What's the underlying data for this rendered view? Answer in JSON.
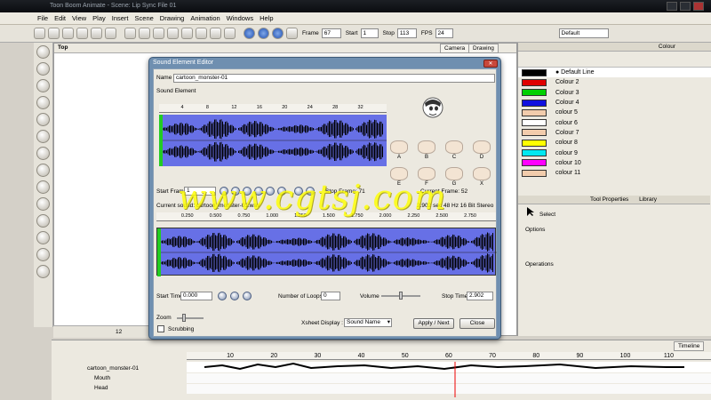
{
  "window": {
    "title": "Toon Boom Animate - Scene: Lip Sync File 01"
  },
  "menu": [
    "File",
    "Edit",
    "View",
    "Play",
    "Insert",
    "Scene",
    "Drawing",
    "Animation",
    "Windows",
    "Help"
  ],
  "toolbar": {
    "frame_label": "Frame",
    "frame_value": "67",
    "start_label": "Start",
    "start_value": "1",
    "stop_label": "Stop",
    "stop_value": "113",
    "fps_label": "FPS",
    "fps_value": "24",
    "workspace": "Default"
  },
  "viewport": {
    "view_label": "Top",
    "tabs": [
      "Camera",
      "Drawing"
    ],
    "zoom": "12"
  },
  "colour_panel": {
    "tab": "Colour",
    "items": [
      {
        "name": "Default Line",
        "color": "#000000"
      },
      {
        "name": "Colour 2",
        "color": "#e00000"
      },
      {
        "name": "Colour 3",
        "color": "#00d000"
      },
      {
        "name": "Colour 4",
        "color": "#1010e0"
      },
      {
        "name": "colour 5",
        "color": "#f2ccac"
      },
      {
        "name": "colour 6",
        "color": "#ffffff"
      },
      {
        "name": "Colour 7",
        "color": "#f2ccac"
      },
      {
        "name": "colour 8",
        "color": "#ffff00"
      },
      {
        "name": "colour 9",
        "color": "#00e8f0"
      },
      {
        "name": "colour 10",
        "color": "#ff00ff"
      },
      {
        "name": "colour 11",
        "color": "#f2ccac"
      }
    ]
  },
  "tool_properties": {
    "tabs": [
      "Tool Properties",
      "Library"
    ],
    "tool": "Select",
    "options_label": "Options",
    "operations_label": "Operations"
  },
  "dialog": {
    "title": "Sound Element Editor",
    "name_label": "Name",
    "name_value": "cartoon_monster-01",
    "section_label": "Sound Element",
    "ruler_ticks": [
      "4",
      "8",
      "12",
      "16",
      "20",
      "24",
      "28",
      "32"
    ],
    "mouth_labels": [
      "A",
      "B",
      "C",
      "D",
      "E",
      "F",
      "G",
      "X"
    ],
    "start_frame_label": "Start Frame",
    "start_frame_value": "1",
    "stop_frame_label": "Stop Frame: 71",
    "current_frame_label": "Current Frame: 52",
    "current_sound_label": "Current sound: cartoon_monster-01.wav",
    "sound_info": "2.902 sec 48 Hz 16 Bit Stereo",
    "time_ticks": [
      "0.250",
      "0.500",
      "0.750",
      "1.000",
      "1.250",
      "1.500",
      "1.750",
      "2.000",
      "2.250",
      "2.500",
      "2.750"
    ],
    "start_time_label": "Start Time",
    "start_time_value": "0.000",
    "loops_label": "Number of Loops",
    "loops_value": "0",
    "volume_label": "Volume",
    "stop_time_label": "Stop Time",
    "stop_time_value": "2.902",
    "zoom_label": "Zoom",
    "scrubbing_label": "Scrubbing",
    "xsheet_label": "Xsheet Display :",
    "xsheet_value": "Sound Name",
    "apply_label": "Apply / Next",
    "close_label": "Close"
  },
  "timeline": {
    "tab": "Timeline",
    "layers": [
      "cartoon_monster-01",
      "Mouth",
      "Head"
    ],
    "frame_ticks": [
      "10",
      "20",
      "30",
      "40",
      "50",
      "60",
      "70",
      "80",
      "90",
      "100",
      "110"
    ]
  },
  "watermark": "www.cgtsj.com"
}
